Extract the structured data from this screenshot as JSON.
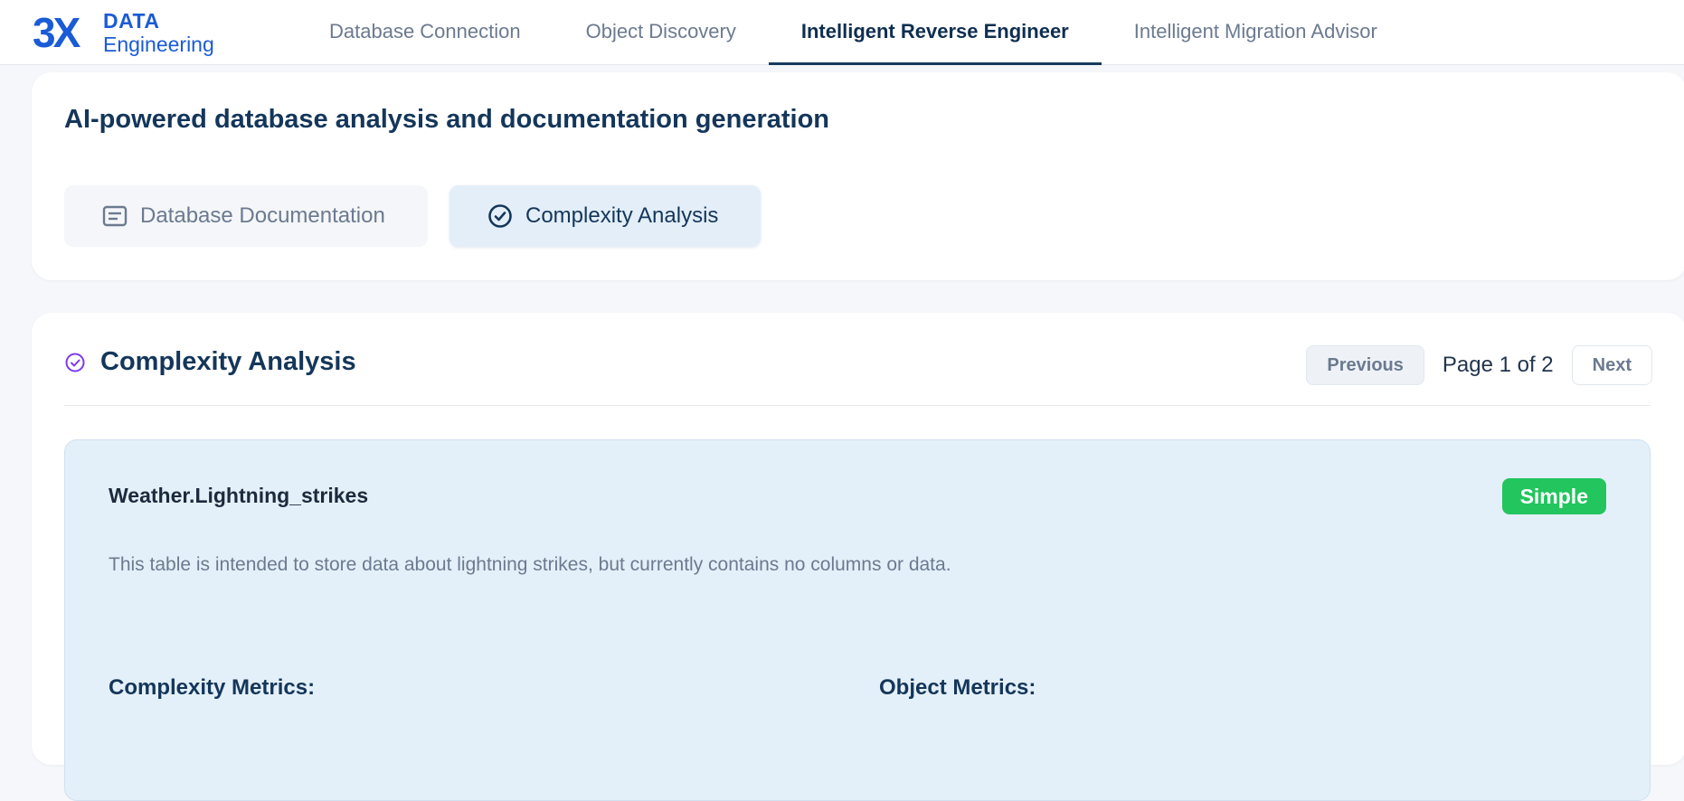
{
  "brand": {
    "line1": "DATA",
    "line2": "Engineering",
    "mark_text": "3X",
    "color": "#1a5bd6"
  },
  "nav": {
    "items": [
      {
        "label": "Database Connection"
      },
      {
        "label": "Object Discovery"
      },
      {
        "label": "Intelligent Reverse Engineer",
        "active": true
      },
      {
        "label": "Intelligent Migration Advisor"
      }
    ]
  },
  "header": {
    "subtitle": "AI-powered database analysis and documentation generation"
  },
  "tabs": {
    "documentation": {
      "label": "Database Documentation",
      "icon": "document-icon"
    },
    "complexity": {
      "label": "Complexity Analysis",
      "icon": "check-circle-icon",
      "selected": true
    }
  },
  "section": {
    "title": "Complexity Analysis",
    "icon": "check-circle-icon",
    "icon_color": "#7c3aed"
  },
  "pagination": {
    "previous_label": "Previous",
    "page_info": "Page 1 of 2",
    "next_label": "Next"
  },
  "object": {
    "name": "Weather.Lightning_strikes",
    "badge": "Simple",
    "badge_color": "#22c55e",
    "description": "This table is intended to store data about lightning strikes, but currently contains no columns or data.",
    "complexity_metrics_heading": "Complexity Metrics:",
    "object_metrics_heading": "Object Metrics:"
  }
}
